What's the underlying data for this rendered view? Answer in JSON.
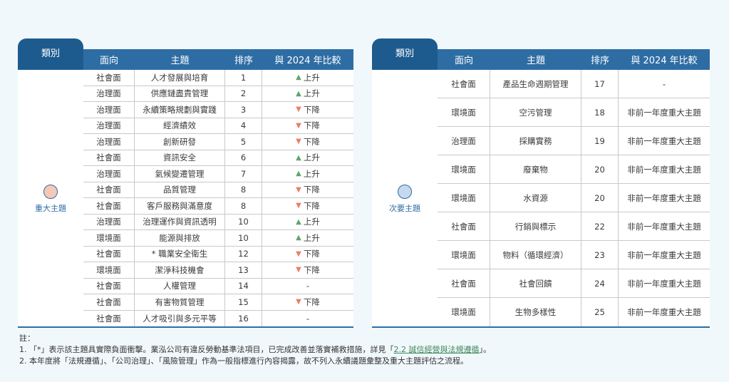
{
  "left": {
    "category_header": "類別",
    "columns": [
      "面向",
      "主題",
      "排序",
      "與 2024 年比較"
    ],
    "category_label": "重大主題",
    "category_color": "#f6c8b8",
    "rows": [
      {
        "facet": "社會面",
        "topic": "人才發展與培育",
        "rank": "1",
        "trend": "up",
        "change": "上升"
      },
      {
        "facet": "治理面",
        "topic": "供應鏈盡責管理",
        "rank": "2",
        "trend": "up",
        "change": "上升"
      },
      {
        "facet": "治理面",
        "topic": "永續策略規劃與實踐",
        "rank": "3",
        "trend": "down",
        "change": "下降"
      },
      {
        "facet": "治理面",
        "topic": "經濟績效",
        "rank": "4",
        "trend": "down",
        "change": "下降"
      },
      {
        "facet": "治理面",
        "topic": "創新研發",
        "rank": "5",
        "trend": "down",
        "change": "下降"
      },
      {
        "facet": "社會面",
        "topic": "資訊安全",
        "rank": "6",
        "trend": "up",
        "change": "上升"
      },
      {
        "facet": "治理面",
        "topic": "氣候變遷管理",
        "rank": "7",
        "trend": "up",
        "change": "上升"
      },
      {
        "facet": "社會面",
        "topic": "品質管理",
        "rank": "8",
        "trend": "down",
        "change": "下降"
      },
      {
        "facet": "社會面",
        "topic": "客戶服務與滿意度",
        "rank": "8",
        "trend": "down",
        "change": "下降"
      },
      {
        "facet": "治理面",
        "topic": "治理運作與資訊透明",
        "rank": "10",
        "trend": "up",
        "change": "上升"
      },
      {
        "facet": "環境面",
        "topic": "能源與排放",
        "rank": "10",
        "trend": "up",
        "change": "上升"
      },
      {
        "facet": "社會面",
        "topic": "* 職業安全衛生",
        "rank": "12",
        "trend": "down",
        "change": "下降"
      },
      {
        "facet": "環境面",
        "topic": "潔淨科技機會",
        "rank": "13",
        "trend": "down",
        "change": "下降"
      },
      {
        "facet": "社會面",
        "topic": "人權管理",
        "rank": "14",
        "trend": "none",
        "change": "-"
      },
      {
        "facet": "社會面",
        "topic": "有害物質管理",
        "rank": "15",
        "trend": "down",
        "change": "下降"
      },
      {
        "facet": "社會面",
        "topic": "人才吸引與多元平等",
        "rank": "16",
        "trend": "none",
        "change": "-"
      }
    ]
  },
  "right": {
    "category_header": "類別",
    "columns": [
      "面向",
      "主題",
      "排序",
      "與 2024 年比較"
    ],
    "category_label": "次要主題",
    "category_color": "#c5d9ee",
    "rows": [
      {
        "facet": "社會面",
        "topic": "產品生命週期管理",
        "rank": "17",
        "trend": "none",
        "change": "-"
      },
      {
        "facet": "環境面",
        "topic": "空污管理",
        "rank": "18",
        "trend": "none",
        "change": "非前一年度重大主題"
      },
      {
        "facet": "治理面",
        "topic": "採購實務",
        "rank": "19",
        "trend": "none",
        "change": "非前一年度重大主題"
      },
      {
        "facet": "環境面",
        "topic": "廢棄物",
        "rank": "20",
        "trend": "none",
        "change": "非前一年度重大主題"
      },
      {
        "facet": "環境面",
        "topic": "水資源",
        "rank": "20",
        "trend": "none",
        "change": "非前一年度重大主題"
      },
      {
        "facet": "社會面",
        "topic": "行銷與標示",
        "rank": "22",
        "trend": "none",
        "change": "非前一年度重大主題"
      },
      {
        "facet": "環境面",
        "topic": "物料（循環經濟）",
        "rank": "23",
        "trend": "none",
        "change": "非前一年度重大主題"
      },
      {
        "facet": "社會面",
        "topic": "社會回饋",
        "rank": "24",
        "trend": "none",
        "change": "非前一年度重大主題"
      },
      {
        "facet": "環境面",
        "topic": "生物多樣性",
        "rank": "25",
        "trend": "none",
        "change": "非前一年度重大主題"
      }
    ]
  },
  "notes": {
    "title": "註：",
    "note1_before": "1. 「*」表示該主題具實際負面衝擊。業泓公司有違反勞動基準法項目，已完成改善並落實補救措施，詳見「",
    "note1_link": "2.2 誠信經營與法規遵循",
    "note1_after": "」。",
    "note2": "2. 本年度將「法規遵循」、「公司治理」、「風險管理」作為一般指標進行內容揭露，故不列入永續議題彙整及重大主題評估之流程。"
  },
  "icons": {
    "up": "triangle-up-icon",
    "down": "triangle-down-icon"
  },
  "colors": {
    "header_dark": "#1d5b8f",
    "header": "#2e6da4",
    "up": "#5ea56a",
    "down": "#ef7c67",
    "link": "#3d8a5a"
  }
}
